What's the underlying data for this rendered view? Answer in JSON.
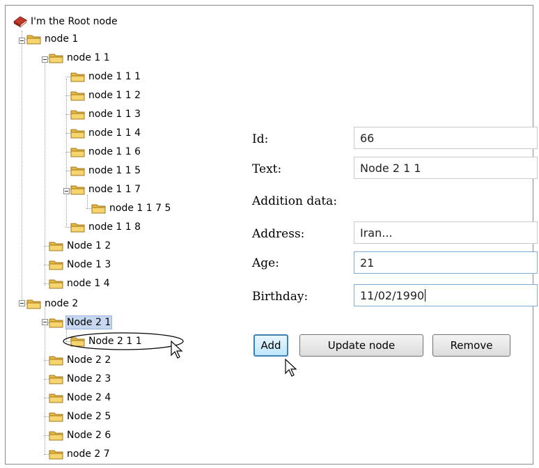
{
  "tree": {
    "root_label": "I'm the Root node",
    "rows": [
      {
        "label": "node 1"
      },
      {
        "label": "node 1 1"
      },
      {
        "label": "node 1 1 1"
      },
      {
        "label": "node 1 1 2"
      },
      {
        "label": "node 1 1 3"
      },
      {
        "label": "node 1 1 4"
      },
      {
        "label": "node 1 1 6"
      },
      {
        "label": "node 1 1 5"
      },
      {
        "label": "node 1 1 7"
      },
      {
        "label": "node 1 1 7 5"
      },
      {
        "label": "node 1 1 8"
      },
      {
        "label": "Node 1 2"
      },
      {
        "label": "Node 1 3"
      },
      {
        "label": "node 1 4"
      },
      {
        "label": "node 2"
      },
      {
        "label": "Node 2 1",
        "selected": true
      },
      {
        "label": "Node 2 1 1"
      },
      {
        "label": "Node 2 2"
      },
      {
        "label": "Node 2 3"
      },
      {
        "label": "Node 2 4"
      },
      {
        "label": "Node 2 5"
      },
      {
        "label": "Node 2 6"
      },
      {
        "label": "node 2 7"
      }
    ]
  },
  "form": {
    "id_label": "Id:",
    "id_value": "66",
    "text_label": "Text:",
    "text_value": "Node 2 1 1",
    "addition_label": "Addition data:",
    "address_label": "Address:",
    "address_value": "Iran...",
    "age_label": "Age:",
    "age_value": "21",
    "birthday_label": "Birthday:",
    "birthday_value": "11/02/1990"
  },
  "buttons": {
    "add": "Add",
    "update": "Update node",
    "remove": "Remove"
  },
  "colors": {
    "selection": "#c7d7f0",
    "focus_border": "#3c7fb1",
    "folder": "#f2c94c"
  }
}
